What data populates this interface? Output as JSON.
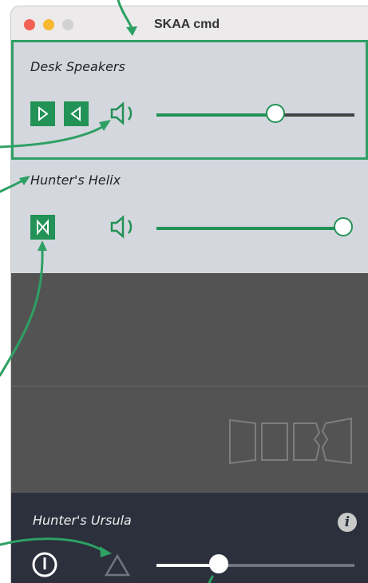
{
  "window": {
    "title": "SKAA cmd"
  },
  "devices": [
    {
      "name": "Desk Speakers",
      "volume": 0.6,
      "selected": true
    },
    {
      "name": "Hunter's Helix",
      "volume": 1.0,
      "selected": false
    }
  ],
  "footer": {
    "device_name": "Hunter's Ursula",
    "volume": 0.3
  },
  "icons": {
    "play_right": "triangle-right-icon",
    "play_left": "triangle-left-icon",
    "speaker": "speaker-icon",
    "bowtie": "bowtie-icon",
    "power": "power-icon",
    "triangle": "triangle-outline-icon",
    "info": "info-icon",
    "logo": "skaa-logo-icon"
  },
  "colors": {
    "accent": "#229256",
    "arrow": "#2ea063",
    "footer_bg": "#2b303c",
    "dark_bg": "#535353"
  }
}
